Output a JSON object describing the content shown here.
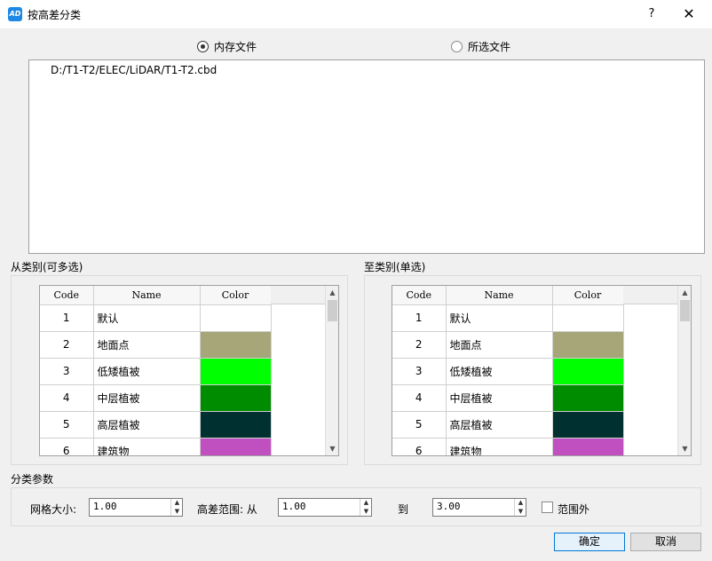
{
  "window": {
    "title": "按高差分类",
    "help": "?",
    "close": "✕",
    "app_icon_text": "AD"
  },
  "source": {
    "memory_file_label": "内存文件",
    "selected_file_label": "所选文件",
    "selected": "memory",
    "files": [
      "D:/T1-T2/ELEC/LiDAR/T1-T2.cbd"
    ]
  },
  "from_group": {
    "label": "从类别(可多选)",
    "columns": [
      "Code",
      "Name",
      "Color"
    ],
    "rows": [
      {
        "code": "1",
        "name": "默认",
        "color": "#ffffff"
      },
      {
        "code": "2",
        "name": "地面点",
        "color": "#a6a679"
      },
      {
        "code": "3",
        "name": "低矮植被",
        "color": "#00ff00"
      },
      {
        "code": "4",
        "name": "中层植被",
        "color": "#008c00"
      },
      {
        "code": "5",
        "name": "高层植被",
        "color": "#003030"
      },
      {
        "code": "6",
        "name": "建筑物",
        "color": "#c050c0"
      }
    ]
  },
  "to_group": {
    "label": "至类别(单选)",
    "columns": [
      "Code",
      "Name",
      "Color"
    ],
    "rows": [
      {
        "code": "1",
        "name": "默认",
        "color": "#ffffff"
      },
      {
        "code": "2",
        "name": "地面点",
        "color": "#a6a679"
      },
      {
        "code": "3",
        "name": "低矮植被",
        "color": "#00ff00"
      },
      {
        "code": "4",
        "name": "中层植被",
        "color": "#008c00"
      },
      {
        "code": "5",
        "name": "高层植被",
        "color": "#003030"
      },
      {
        "code": "6",
        "name": "建筑物",
        "color": "#c050c0"
      }
    ]
  },
  "params": {
    "label": "分类参数",
    "grid_size_label": "网格大小:",
    "grid_size": "1.00",
    "height_range_label": "高差范围: 从",
    "height_from": "1.00",
    "to_label": "到",
    "height_to": "3.00",
    "outside_label": "范围外",
    "outside_checked": false
  },
  "buttons": {
    "ok": "确定",
    "cancel": "取消"
  }
}
